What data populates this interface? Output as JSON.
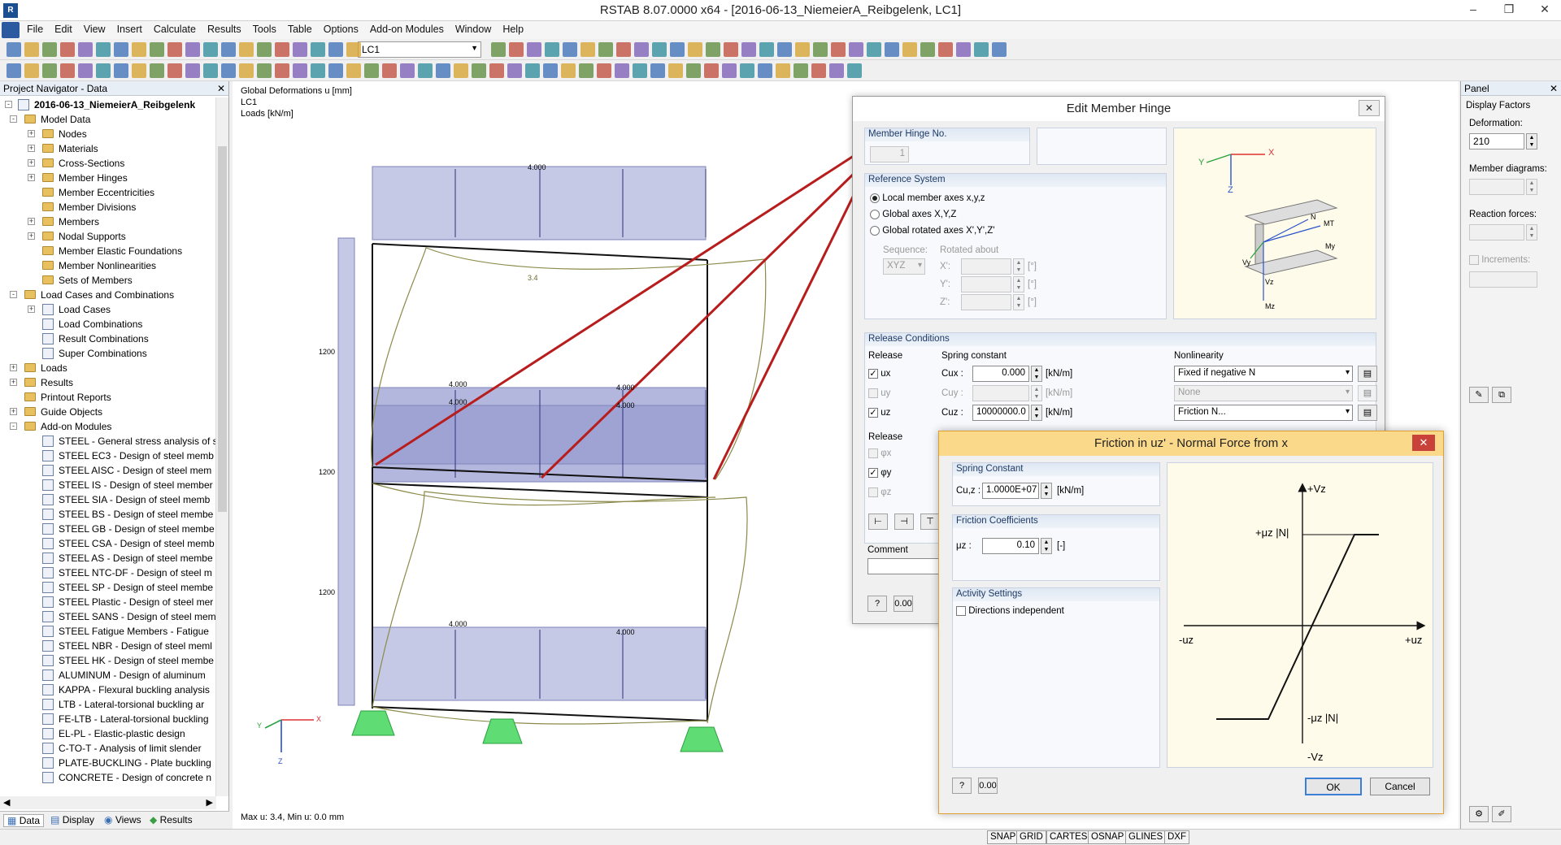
{
  "window": {
    "title": "RSTAB 8.07.0000 x64 - [2016-06-13_NiemeierA_Reibgelenk, LC1]"
  },
  "menu": [
    "File",
    "Edit",
    "View",
    "Insert",
    "Calculate",
    "Results",
    "Tools",
    "Table",
    "Options",
    "Add-on Modules",
    "Window",
    "Help"
  ],
  "toolbar": {
    "load_case": "LC1"
  },
  "navigator": {
    "title": "Project Navigator - Data",
    "tree": [
      {
        "label": "2016-06-13_NiemeierA_Reibgelenk",
        "level": 0,
        "exp": "-",
        "type": "root",
        "bold": true
      },
      {
        "label": "Model Data",
        "level": 1,
        "exp": "-",
        "type": "folder"
      },
      {
        "label": "Nodes",
        "level": 2,
        "exp": "+",
        "type": "folder"
      },
      {
        "label": "Materials",
        "level": 2,
        "exp": "+",
        "type": "folder"
      },
      {
        "label": "Cross-Sections",
        "level": 2,
        "exp": "+",
        "type": "folder"
      },
      {
        "label": "Member Hinges",
        "level": 2,
        "exp": "+",
        "type": "folder"
      },
      {
        "label": "Member Eccentricities",
        "level": 2,
        "exp": "",
        "type": "folder"
      },
      {
        "label": "Member Divisions",
        "level": 2,
        "exp": "",
        "type": "folder"
      },
      {
        "label": "Members",
        "level": 2,
        "exp": "+",
        "type": "folder"
      },
      {
        "label": "Nodal Supports",
        "level": 2,
        "exp": "+",
        "type": "folder"
      },
      {
        "label": "Member Elastic Foundations",
        "level": 2,
        "exp": "",
        "type": "folder"
      },
      {
        "label": "Member Nonlinearities",
        "level": 2,
        "exp": "",
        "type": "folder"
      },
      {
        "label": "Sets of Members",
        "level": 2,
        "exp": "",
        "type": "folder"
      },
      {
        "label": "Load Cases and Combinations",
        "level": 1,
        "exp": "-",
        "type": "folder"
      },
      {
        "label": "Load Cases",
        "level": 2,
        "exp": "+",
        "type": "item"
      },
      {
        "label": "Load Combinations",
        "level": 2,
        "exp": "",
        "type": "item"
      },
      {
        "label": "Result Combinations",
        "level": 2,
        "exp": "",
        "type": "item"
      },
      {
        "label": "Super Combinations",
        "level": 2,
        "exp": "",
        "type": "item"
      },
      {
        "label": "Loads",
        "level": 1,
        "exp": "+",
        "type": "folder"
      },
      {
        "label": "Results",
        "level": 1,
        "exp": "+",
        "type": "folder"
      },
      {
        "label": "Printout Reports",
        "level": 1,
        "exp": "",
        "type": "folder"
      },
      {
        "label": "Guide Objects",
        "level": 1,
        "exp": "+",
        "type": "folder"
      },
      {
        "label": "Add-on Modules",
        "level": 1,
        "exp": "-",
        "type": "folder"
      },
      {
        "label": "STEEL - General stress analysis of s",
        "level": 2,
        "exp": "",
        "type": "module"
      },
      {
        "label": "STEEL EC3 - Design of steel memb",
        "level": 2,
        "exp": "",
        "type": "module"
      },
      {
        "label": "STEEL AISC - Design of steel mem",
        "level": 2,
        "exp": "",
        "type": "module"
      },
      {
        "label": "STEEL IS - Design of steel member",
        "level": 2,
        "exp": "",
        "type": "module"
      },
      {
        "label": "STEEL SIA - Design of steel memb",
        "level": 2,
        "exp": "",
        "type": "module"
      },
      {
        "label": "STEEL BS - Design of steel membe",
        "level": 2,
        "exp": "",
        "type": "module"
      },
      {
        "label": "STEEL GB - Design of steel membe",
        "level": 2,
        "exp": "",
        "type": "module"
      },
      {
        "label": "STEEL CSA - Design of steel memb",
        "level": 2,
        "exp": "",
        "type": "module"
      },
      {
        "label": "STEEL AS - Design of steel membe",
        "level": 2,
        "exp": "",
        "type": "module"
      },
      {
        "label": "STEEL NTC-DF - Design of steel m",
        "level": 2,
        "exp": "",
        "type": "module"
      },
      {
        "label": "STEEL SP - Design of steel membe",
        "level": 2,
        "exp": "",
        "type": "module"
      },
      {
        "label": "STEEL Plastic - Design of steel mer",
        "level": 2,
        "exp": "",
        "type": "module"
      },
      {
        "label": "STEEL SANS - Design of steel mem",
        "level": 2,
        "exp": "",
        "type": "module"
      },
      {
        "label": "STEEL Fatigue Members - Fatigue",
        "level": 2,
        "exp": "",
        "type": "module"
      },
      {
        "label": "STEEL NBR - Design of steel meml",
        "level": 2,
        "exp": "",
        "type": "module"
      },
      {
        "label": "STEEL HK - Design of steel membe",
        "level": 2,
        "exp": "",
        "type": "module"
      },
      {
        "label": "ALUMINUM - Design of aluminum",
        "level": 2,
        "exp": "",
        "type": "module"
      },
      {
        "label": "KAPPA - Flexural buckling analysis",
        "level": 2,
        "exp": "",
        "type": "module"
      },
      {
        "label": "LTB - Lateral-torsional buckling ar",
        "level": 2,
        "exp": "",
        "type": "module"
      },
      {
        "label": "FE-LTB - Lateral-torsional buckling",
        "level": 2,
        "exp": "",
        "type": "module"
      },
      {
        "label": "EL-PL - Elastic-plastic design",
        "level": 2,
        "exp": "",
        "type": "module"
      },
      {
        "label": "C-TO-T - Analysis of limit slender",
        "level": 2,
        "exp": "",
        "type": "module"
      },
      {
        "label": "PLATE-BUCKLING - Plate buckling",
        "level": 2,
        "exp": "",
        "type": "module"
      },
      {
        "label": "CONCRETE - Design of concrete n",
        "level": 2,
        "exp": "",
        "type": "module"
      }
    ],
    "tabs": [
      "Data",
      "Display",
      "Views",
      "Results"
    ]
  },
  "canvas": {
    "info": [
      "Global Deformations u [mm]",
      "LC1",
      "Loads [kN/m]"
    ],
    "status": "Max u: 3.4, Min u: 0.0 mm",
    "loads_top": "4.000",
    "loads_mid": [
      "4.000",
      "4.000",
      "4.000",
      "4.000"
    ],
    "loads_bottom": [
      "4.000",
      "4.000"
    ],
    "dims": [
      "1200",
      "1200",
      "1200"
    ],
    "max_u": "3.4",
    "axes": {
      "x": "X",
      "y": "Y",
      "z": "Z"
    }
  },
  "panel": {
    "title": "Panel",
    "display_factors": "Display Factors",
    "deformation_label": "Deformation:",
    "deformation_value": "210",
    "member_diagrams": "Member diagrams:",
    "reaction_forces": "Reaction forces:",
    "increments": "Increments:"
  },
  "statusbar": [
    "SNAP",
    "GRID",
    "CARTES",
    "OSNAP",
    "GLINES",
    "DXF"
  ],
  "edit_hinge": {
    "title": "Edit Member Hinge",
    "hinge_no_label": "Member Hinge No.",
    "hinge_no": "1",
    "ref_system": "Reference System",
    "ref_options": [
      "Local member axes x,y,z",
      "Global axes X,Y,Z",
      "Global rotated axes X',Y',Z'"
    ],
    "sequence_label": "Sequence:",
    "sequence_value": "XYZ",
    "rotated_about": "Rotated about",
    "rot_axes": [
      "X':",
      "Y':",
      "Z':"
    ],
    "deg": "[°]",
    "release_conditions": "Release Conditions",
    "release": "Release",
    "spring_constant": "Spring constant",
    "nonlinearity": "Nonlinearity",
    "ux": "ux",
    "uy": "uy",
    "uz": "uz",
    "cux": "Cux",
    "cuy": "Cuy",
    "cuz": "Cuz",
    "cux_val": "0.000",
    "cuy_val": "",
    "cuz_val": "10000000.0",
    "unit": "[kN/m]",
    "nl_x": "Fixed if negative N",
    "nl_y": "None",
    "nl_z": "Friction N...",
    "release2": "Release",
    "phi": [
      "φx",
      "φy",
      "φz"
    ],
    "comment": "Comment",
    "diagram_labels": {
      "x": "X",
      "y": "Y",
      "z": "Z",
      "N": "N",
      "Vy": "Vy",
      "Vz": "Vz",
      "Mt": "MT",
      "My": "My",
      "Mz": "Mz"
    }
  },
  "friction": {
    "title": "Friction in uz' - Normal Force from x",
    "spring_constant": "Spring Constant",
    "cuz_label": "Cu,z :",
    "cuz_val": "1.0000E+07",
    "unit": "[kN/m]",
    "coeff": "Friction Coefficients",
    "mu_label": "μz :",
    "mu_val": "0.10",
    "mu_unit": "[-]",
    "activity": "Activity Settings",
    "directions": "Directions independent",
    "ok": "OK",
    "cancel": "Cancel",
    "graph": {
      "vz_pos": "+Vz",
      "vz_neg": "-Vz",
      "uz_pos": "+uz",
      "uz_neg": "-uz",
      "mu_pos": "+μz |N|",
      "mu_neg": "-μz |N|"
    }
  }
}
